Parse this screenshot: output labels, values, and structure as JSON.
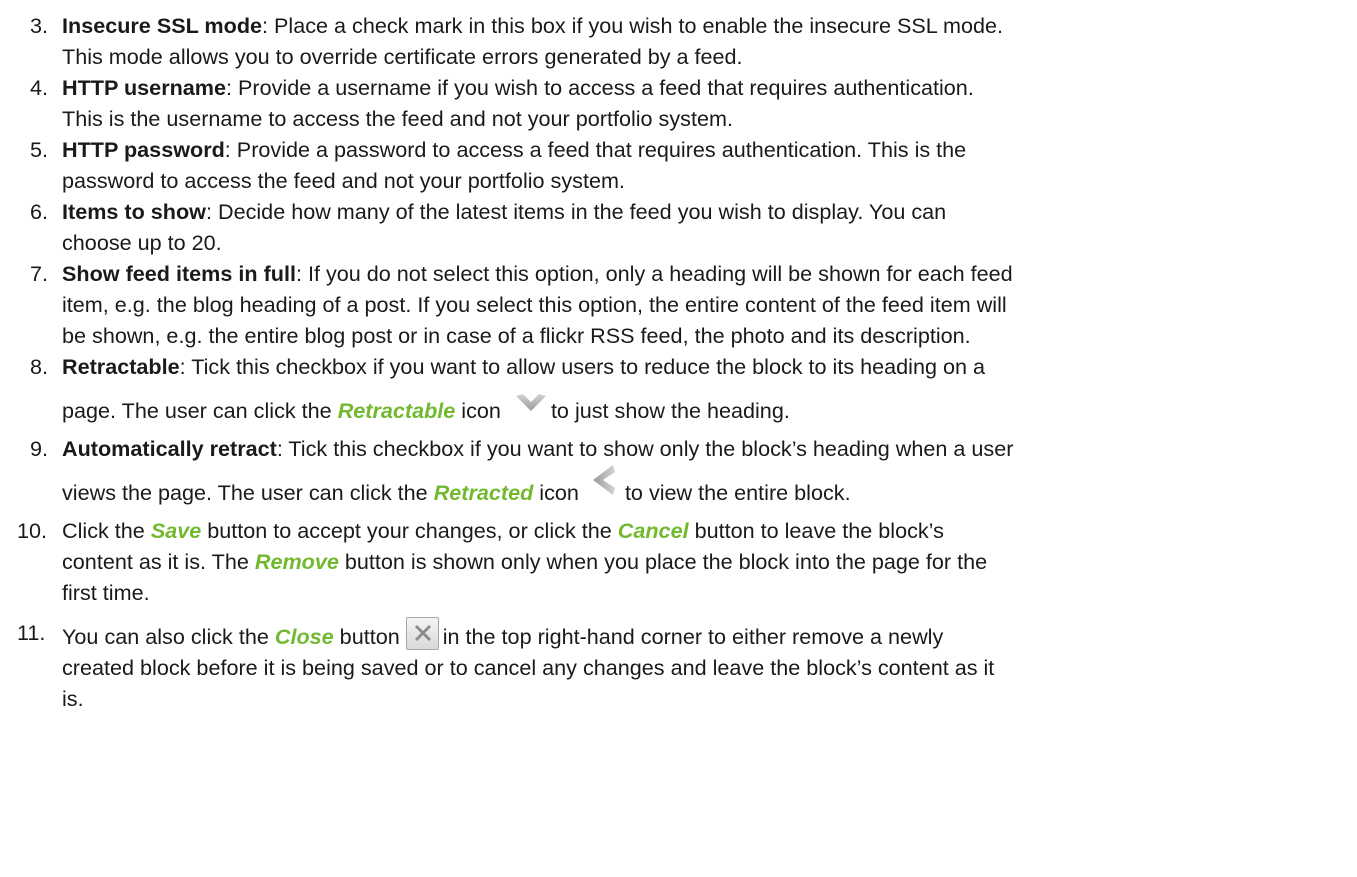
{
  "items": [
    {
      "num": "3.",
      "term": "Insecure SSL mode",
      "text_a": ": Place a check mark in this box if you wish to enable the insecure SSL mode.",
      "text_b": "This mode allows you to override certificate errors generated by a feed."
    },
    {
      "num": "4.",
      "term": "HTTP username",
      "text_a": ": Provide a username if you wish to access a feed that requires authentication.",
      "text_b": "This is the username to access the feed and not your portfolio system."
    },
    {
      "num": "5.",
      "term": "HTTP password",
      "text_a": ": Provide a password to access a feed that requires authentication. This is the",
      "text_b": "password to access the feed and not your portfolio system."
    },
    {
      "num": "6.",
      "term": "Items to show",
      "text_a": ": Decide how many of the latest items in the feed you wish to display. You can",
      "text_b": "choose up to 20."
    },
    {
      "num": "7.",
      "term": "Show feed items in full",
      "text_a": ": If you do not select this option, only a heading will be shown for each feed",
      "text_b": "item, e.g. the blog heading of a post. If you select this option, the entire content of the feed item will",
      "text_c": "be shown, e.g. the entire blog post or in case of a flickr RSS feed, the photo and its description."
    },
    {
      "num": "8.",
      "term": "Retractable",
      "text_a": ": Tick this checkbox if you want to allow users to reduce the block to its heading on a",
      "text_b": "page. The user can click the ",
      "highlight": "Retractable",
      "text_c": " icon",
      "icon": "chevron-down-icon",
      "text_d": "to just show the heading."
    },
    {
      "num": "9.",
      "term": "Automatically retract",
      "text_a": ": Tick this checkbox if you want to show only the block’s heading when a user",
      "text_b": "views the page. The user can click the ",
      "highlight": "Retracted",
      "text_c": " icon",
      "icon": "chevron-left-icon",
      "text_d": "to view the entire block."
    },
    {
      "num": "10.",
      "text_a": "Click the ",
      "hl_save": "Save",
      "text_b": " button to accept your changes, or click the ",
      "hl_cancel": "Cancel",
      "text_c": " button to leave the block’s",
      "text_d": "content as it is. The ",
      "hl_remove": "Remove",
      "text_e": " button is shown only when you place the block into the page for the",
      "text_f": "first time."
    },
    {
      "num": "11.",
      "text_a": "You can also click the ",
      "hl_close": "Close",
      "text_b": " button",
      "icon": "close-icon",
      "text_c": "in the top right-hand corner to either remove a newly",
      "text_d": "created block before it is being saved or to cancel any changes and leave the block’s content as it",
      "text_e": "is."
    }
  ],
  "colors": {
    "highlight": "#73b930",
    "text": "#1a1a1a"
  }
}
